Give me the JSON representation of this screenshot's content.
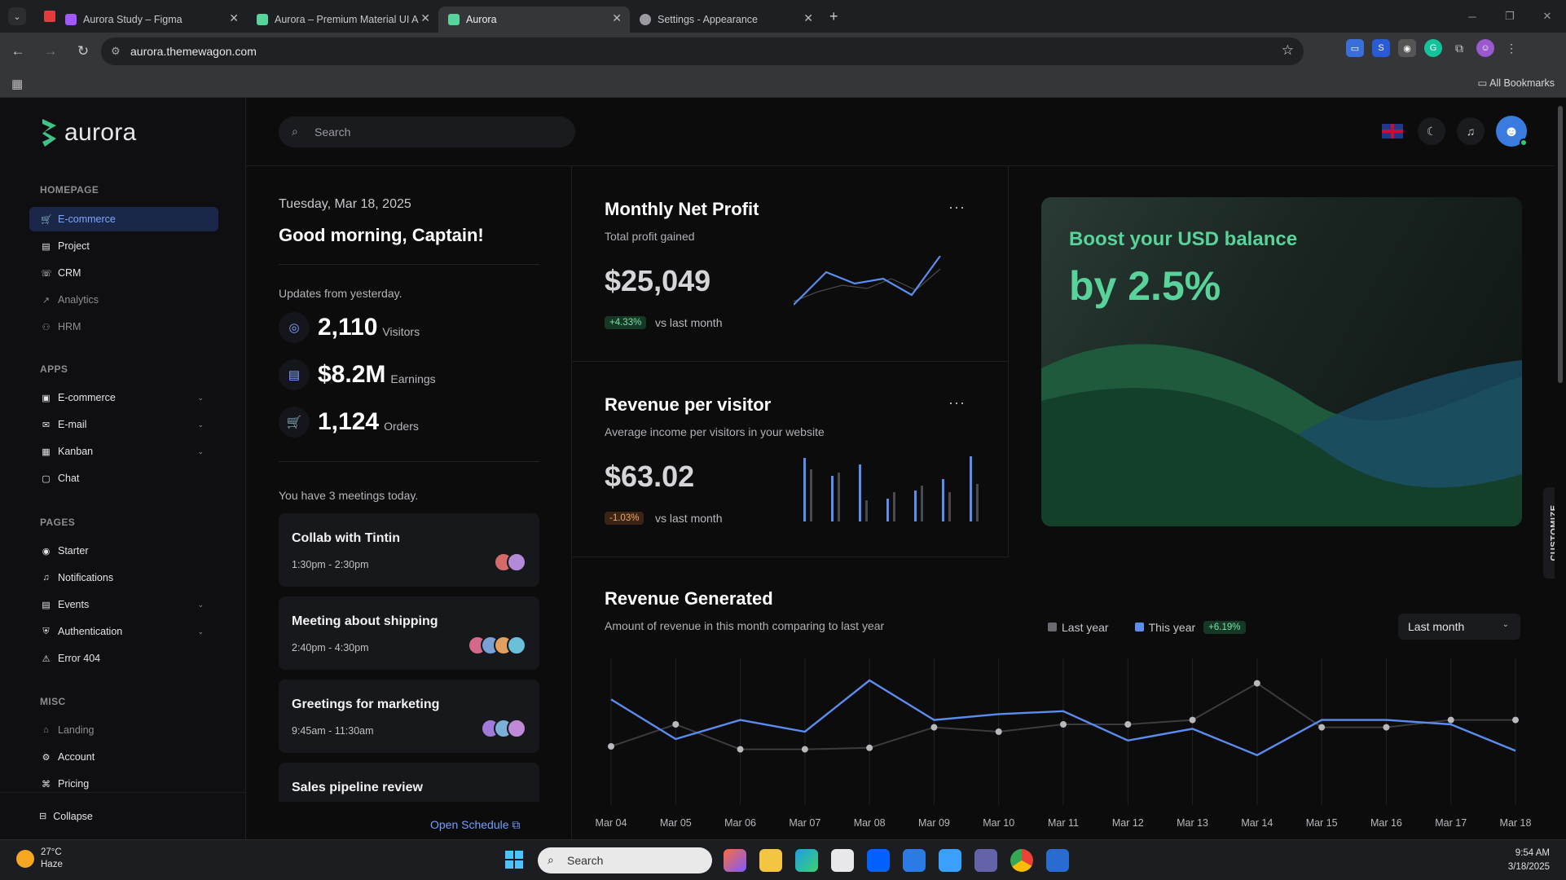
{
  "browser": {
    "tabs": [
      {
        "title": "Aurora Study – Figma",
        "fav_color": "#a259ff"
      },
      {
        "title": "Aurora – Premium Material UI A",
        "fav_color": "#58d39a"
      },
      {
        "title": "Aurora",
        "fav_color": "#58d39a"
      },
      {
        "title": "Settings - Appearance",
        "fav_color": "#9a9aa0"
      }
    ],
    "url": "aurora.themewagon.com",
    "bookmarks_label": "All Bookmarks"
  },
  "sidebar": {
    "logo_text": "aurora",
    "sections": {
      "homepage": "HOMEPAGE",
      "apps": "APPS",
      "pages": "PAGES",
      "misc": "MISC"
    },
    "homepage_items": [
      "E-commerce",
      "Project",
      "CRM",
      "Analytics",
      "HRM"
    ],
    "apps_items": [
      "E-commerce",
      "E-mail",
      "Kanban",
      "Chat"
    ],
    "pages_items": [
      "Starter",
      "Notifications",
      "Events",
      "Authentication",
      "Error 404"
    ],
    "misc_items": [
      "Landing",
      "Account",
      "Pricing"
    ],
    "collapse_label": "Collapse"
  },
  "topbar": {
    "search_placeholder": "Search"
  },
  "welcome": {
    "date": "Tuesday, Mar 18, 2025",
    "greeting": "Good morning,  Captain!",
    "updates_label": "Updates from yesterday.",
    "stats": [
      {
        "value": "2,110",
        "label": "Visitors"
      },
      {
        "value": "$8.2M",
        "label": "Earnings"
      },
      {
        "value": "1,124",
        "label": "Orders"
      }
    ],
    "meetings_label": "You have 3 meetings today.",
    "meetings": [
      {
        "title": "Collab with Tintin",
        "time": "1:30pm - 2:30pm"
      },
      {
        "title": "Meeting about shipping",
        "time": "2:40pm - 4:30pm"
      },
      {
        "title": "Greetings for marketing",
        "time": "9:45am - 11:30am"
      },
      {
        "title": "Sales pipeline review",
        "time": ""
      }
    ],
    "open_schedule": "Open Schedule"
  },
  "profit_card": {
    "title": "Monthly Net Profit",
    "subtitle": "Total profit gained",
    "value": "$25,049",
    "change": "+4.33%",
    "vs": "vs last month"
  },
  "rpv_card": {
    "title": "Revenue per visitor",
    "subtitle": "Average income per visitors in your website",
    "value": "$63.02",
    "change": "-1.03%",
    "vs": "vs last month"
  },
  "promo": {
    "line1": "Boost your USD balance",
    "line2": "by 2.5%"
  },
  "customize_label": "CUSTOMIZE",
  "revenue": {
    "title": "Revenue Generated",
    "subtitle": "Amount of revenue in this month comparing to last year",
    "legend_last": "Last year",
    "legend_this": "This year",
    "change": "+6.19%",
    "period": "Last month"
  },
  "chart_data": {
    "type": "line",
    "x": [
      "Mar 04",
      "Mar 05",
      "Mar 06",
      "Mar 07",
      "Mar 08",
      "Mar 09",
      "Mar 10",
      "Mar 11",
      "Mar 12",
      "Mar 13",
      "Mar 14",
      "Mar 15",
      "Mar 16",
      "Mar 17",
      "Mar 18"
    ],
    "series": [
      {
        "name": "This year",
        "color": "#5b8def",
        "values": [
          72,
          45,
          58,
          50,
          85,
          58,
          62,
          64,
          44,
          52,
          34,
          58,
          58,
          55,
          37
        ]
      },
      {
        "name": "Last year",
        "color": "#5a5a5e",
        "values": [
          40,
          55,
          38,
          38,
          39,
          53,
          50,
          55,
          55,
          58,
          83,
          53,
          53,
          58,
          58
        ]
      }
    ],
    "grid": true,
    "legend": "top-right"
  },
  "taskbar": {
    "weather_temp": "27°C",
    "weather_desc": "Haze",
    "search_label": "Search",
    "time": "9:54 AM",
    "date": "3/18/2025"
  }
}
